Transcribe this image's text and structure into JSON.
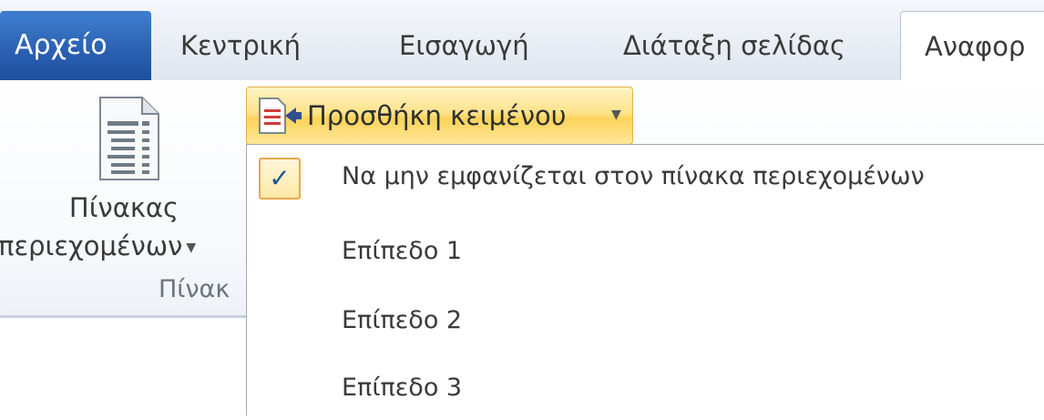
{
  "tabs": {
    "file": "Αρχείο",
    "home": "Κεντρική",
    "insert": "Εισαγωγή",
    "page_layout": "Διάταξη σελίδας",
    "references": "Αναφορ"
  },
  "ribbon": {
    "toc_button": {
      "label_line1": "Πίνακας",
      "label_line2": "περιεχομένων",
      "icon": "table-of-contents-icon"
    },
    "group_label": "Πίνακ",
    "add_text_button": {
      "label": "Προσθήκη κειμένου",
      "icon": "add-text-icon",
      "dropdown_arrow": "chevron-down-icon"
    }
  },
  "dropdown_menu": {
    "items": [
      {
        "label": "Να μην εμφανίζεται στον πίνακα περιεχομένων",
        "checked": true,
        "check_glyph": "✓"
      },
      {
        "label": "Επίπεδο 1",
        "checked": false
      },
      {
        "label": "Επίπεδο 2",
        "checked": false
      },
      {
        "label": "Επίπεδο 3",
        "checked": false
      }
    ]
  },
  "colors": {
    "file_tab": "#2a5fb0",
    "highlight_gold": "#fbd35a",
    "check_border": "#e7a94a"
  }
}
